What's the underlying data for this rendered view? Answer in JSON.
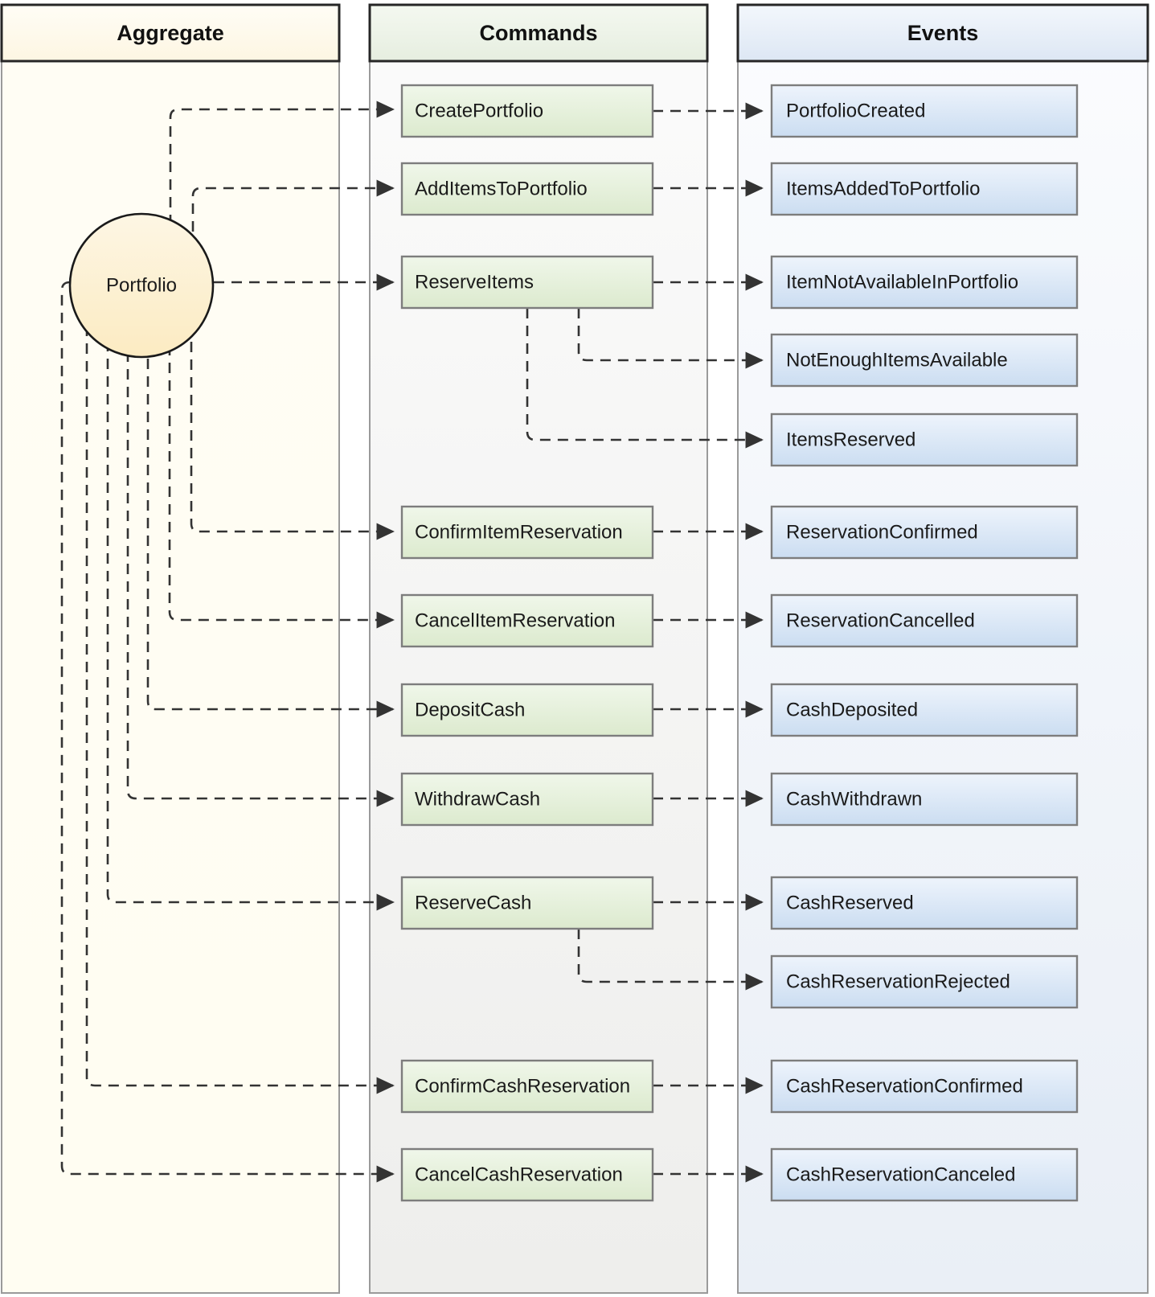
{
  "diagram": {
    "type": "event-modeling-flowchart",
    "columns": [
      {
        "id": "aggregate",
        "title": "Aggregate",
        "fill_top": "#fffdf4",
        "fill_bottom": "#fffdf4",
        "header_fill": "#fdf8e8"
      },
      {
        "id": "commands",
        "title": "Commands",
        "fill_top": "#fafafa",
        "fill_bottom": "#efefef",
        "header_fill": "#eef3e9"
      },
      {
        "id": "events",
        "title": "Events",
        "fill_top": "#fafcfe",
        "fill_bottom": "#edf2f8",
        "header_fill": "#e4ebf5"
      }
    ],
    "aggregate": {
      "nodes": [
        {
          "id": "portfolio",
          "label": "Portfolio",
          "shape": "circle",
          "fill": "#fdf0cf",
          "stroke": "#1a1a1a"
        }
      ]
    },
    "commands": {
      "style": {
        "fill_top": "#eef5e7",
        "fill_bottom": "#dfedd3",
        "stroke": "#7d7d7d"
      },
      "nodes": [
        {
          "id": "CreatePortfolio",
          "label": "CreatePortfolio"
        },
        {
          "id": "AddItemsToPortfolio",
          "label": "AddItemsToPortfolio"
        },
        {
          "id": "ReserveItems",
          "label": "ReserveItems"
        },
        {
          "id": "ConfirmItemReservation",
          "label": "ConfirmItemReservation"
        },
        {
          "id": "CancelItemReservation",
          "label": "CancelItemReservation"
        },
        {
          "id": "DepositCash",
          "label": "DepositCash"
        },
        {
          "id": "WithdrawCash",
          "label": "WithdrawCash"
        },
        {
          "id": "ReserveCash",
          "label": "ReserveCash"
        },
        {
          "id": "ConfirmCashReservation",
          "label": "ConfirmCashReservation"
        },
        {
          "id": "CancelCashReservation",
          "label": "CancelCashReservation"
        }
      ]
    },
    "events": {
      "style": {
        "fill_top": "#edf3fb",
        "fill_bottom": "#cfe0f3",
        "stroke": "#7d7d7d"
      },
      "nodes": [
        {
          "id": "PortfolioCreated",
          "label": "PortfolioCreated"
        },
        {
          "id": "ItemsAddedToPortfolio",
          "label": "ItemsAddedToPortfolio"
        },
        {
          "id": "ItemNotAvailableInPortfolio",
          "label": "ItemNotAvailableInPortfolio"
        },
        {
          "id": "NotEnoughItemsAvailable",
          "label": "NotEnoughItemsAvailable"
        },
        {
          "id": "ItemsReserved",
          "label": "ItemsReserved"
        },
        {
          "id": "ReservationConfirmed",
          "label": "ReservationConfirmed"
        },
        {
          "id": "ReservationCancelled",
          "label": "ReservationCancelled"
        },
        {
          "id": "CashDeposited",
          "label": "CashDeposited"
        },
        {
          "id": "CashWithdrawn",
          "label": "CashWithdrawn"
        },
        {
          "id": "CashReserved",
          "label": "CashReserved"
        },
        {
          "id": "CashReservationRejected",
          "label": "CashReservationRejected"
        },
        {
          "id": "CashReservationConfirmed",
          "label": "CashReservationConfirmed"
        },
        {
          "id": "CashReservationCanceled",
          "label": "CashReservationCanceled"
        }
      ]
    },
    "edges": [
      {
        "from": "Portfolio",
        "to": "CreatePortfolio"
      },
      {
        "from": "Portfolio",
        "to": "AddItemsToPortfolio"
      },
      {
        "from": "Portfolio",
        "to": "ReserveItems"
      },
      {
        "from": "Portfolio",
        "to": "ConfirmItemReservation"
      },
      {
        "from": "Portfolio",
        "to": "CancelItemReservation"
      },
      {
        "from": "Portfolio",
        "to": "DepositCash"
      },
      {
        "from": "Portfolio",
        "to": "WithdrawCash"
      },
      {
        "from": "Portfolio",
        "to": "ReserveCash"
      },
      {
        "from": "Portfolio",
        "to": "ConfirmCashReservation"
      },
      {
        "from": "Portfolio",
        "to": "CancelCashReservation"
      },
      {
        "from": "CreatePortfolio",
        "to": "PortfolioCreated"
      },
      {
        "from": "AddItemsToPortfolio",
        "to": "ItemsAddedToPortfolio"
      },
      {
        "from": "ReserveItems",
        "to": "ItemNotAvailableInPortfolio"
      },
      {
        "from": "ReserveItems",
        "to": "NotEnoughItemsAvailable"
      },
      {
        "from": "ReserveItems",
        "to": "ItemsReserved"
      },
      {
        "from": "ConfirmItemReservation",
        "to": "ReservationConfirmed"
      },
      {
        "from": "CancelItemReservation",
        "to": "ReservationCancelled"
      },
      {
        "from": "DepositCash",
        "to": "CashDeposited"
      },
      {
        "from": "WithdrawCash",
        "to": "CashWithdrawn"
      },
      {
        "from": "ReserveCash",
        "to": "CashReserved"
      },
      {
        "from": "ReserveCash",
        "to": "CashReservationRejected"
      },
      {
        "from": "ConfirmCashReservation",
        "to": "CashReservationConfirmed"
      },
      {
        "from": "CancelCashReservation",
        "to": "CashReservationCanceled"
      }
    ]
  }
}
